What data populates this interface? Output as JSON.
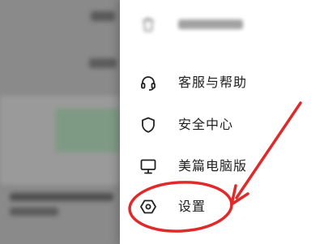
{
  "drawer": {
    "items": [
      {
        "label": "",
        "icon": "trash-icon"
      },
      {
        "label": "客服与帮助",
        "icon": "headset-icon"
      },
      {
        "label": "安全中心",
        "icon": "shield-icon"
      },
      {
        "label": "美篇电脑版",
        "icon": "monitor-icon"
      },
      {
        "label": "设置",
        "icon": "hexagon-settings-icon"
      }
    ]
  },
  "annotation": {
    "color": "#e02a2a"
  }
}
